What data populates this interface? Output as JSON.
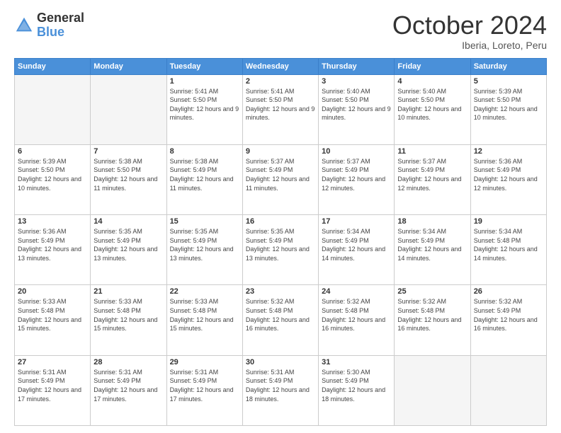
{
  "logo": {
    "general": "General",
    "blue": "Blue"
  },
  "header": {
    "month": "October 2024",
    "location": "Iberia, Loreto, Peru"
  },
  "weekdays": [
    "Sunday",
    "Monday",
    "Tuesday",
    "Wednesday",
    "Thursday",
    "Friday",
    "Saturday"
  ],
  "weeks": [
    [
      {
        "day": "",
        "info": ""
      },
      {
        "day": "",
        "info": ""
      },
      {
        "day": "1",
        "info": "Sunrise: 5:41 AM\nSunset: 5:50 PM\nDaylight: 12 hours and 9 minutes."
      },
      {
        "day": "2",
        "info": "Sunrise: 5:41 AM\nSunset: 5:50 PM\nDaylight: 12 hours and 9 minutes."
      },
      {
        "day": "3",
        "info": "Sunrise: 5:40 AM\nSunset: 5:50 PM\nDaylight: 12 hours and 9 minutes."
      },
      {
        "day": "4",
        "info": "Sunrise: 5:40 AM\nSunset: 5:50 PM\nDaylight: 12 hours and 10 minutes."
      },
      {
        "day": "5",
        "info": "Sunrise: 5:39 AM\nSunset: 5:50 PM\nDaylight: 12 hours and 10 minutes."
      }
    ],
    [
      {
        "day": "6",
        "info": "Sunrise: 5:39 AM\nSunset: 5:50 PM\nDaylight: 12 hours and 10 minutes."
      },
      {
        "day": "7",
        "info": "Sunrise: 5:38 AM\nSunset: 5:50 PM\nDaylight: 12 hours and 11 minutes."
      },
      {
        "day": "8",
        "info": "Sunrise: 5:38 AM\nSunset: 5:49 PM\nDaylight: 12 hours and 11 minutes."
      },
      {
        "day": "9",
        "info": "Sunrise: 5:37 AM\nSunset: 5:49 PM\nDaylight: 12 hours and 11 minutes."
      },
      {
        "day": "10",
        "info": "Sunrise: 5:37 AM\nSunset: 5:49 PM\nDaylight: 12 hours and 12 minutes."
      },
      {
        "day": "11",
        "info": "Sunrise: 5:37 AM\nSunset: 5:49 PM\nDaylight: 12 hours and 12 minutes."
      },
      {
        "day": "12",
        "info": "Sunrise: 5:36 AM\nSunset: 5:49 PM\nDaylight: 12 hours and 12 minutes."
      }
    ],
    [
      {
        "day": "13",
        "info": "Sunrise: 5:36 AM\nSunset: 5:49 PM\nDaylight: 12 hours and 13 minutes."
      },
      {
        "day": "14",
        "info": "Sunrise: 5:35 AM\nSunset: 5:49 PM\nDaylight: 12 hours and 13 minutes."
      },
      {
        "day": "15",
        "info": "Sunrise: 5:35 AM\nSunset: 5:49 PM\nDaylight: 12 hours and 13 minutes."
      },
      {
        "day": "16",
        "info": "Sunrise: 5:35 AM\nSunset: 5:49 PM\nDaylight: 12 hours and 13 minutes."
      },
      {
        "day": "17",
        "info": "Sunrise: 5:34 AM\nSunset: 5:49 PM\nDaylight: 12 hours and 14 minutes."
      },
      {
        "day": "18",
        "info": "Sunrise: 5:34 AM\nSunset: 5:49 PM\nDaylight: 12 hours and 14 minutes."
      },
      {
        "day": "19",
        "info": "Sunrise: 5:34 AM\nSunset: 5:48 PM\nDaylight: 12 hours and 14 minutes."
      }
    ],
    [
      {
        "day": "20",
        "info": "Sunrise: 5:33 AM\nSunset: 5:48 PM\nDaylight: 12 hours and 15 minutes."
      },
      {
        "day": "21",
        "info": "Sunrise: 5:33 AM\nSunset: 5:48 PM\nDaylight: 12 hours and 15 minutes."
      },
      {
        "day": "22",
        "info": "Sunrise: 5:33 AM\nSunset: 5:48 PM\nDaylight: 12 hours and 15 minutes."
      },
      {
        "day": "23",
        "info": "Sunrise: 5:32 AM\nSunset: 5:48 PM\nDaylight: 12 hours and 16 minutes."
      },
      {
        "day": "24",
        "info": "Sunrise: 5:32 AM\nSunset: 5:48 PM\nDaylight: 12 hours and 16 minutes."
      },
      {
        "day": "25",
        "info": "Sunrise: 5:32 AM\nSunset: 5:48 PM\nDaylight: 12 hours and 16 minutes."
      },
      {
        "day": "26",
        "info": "Sunrise: 5:32 AM\nSunset: 5:49 PM\nDaylight: 12 hours and 16 minutes."
      }
    ],
    [
      {
        "day": "27",
        "info": "Sunrise: 5:31 AM\nSunset: 5:49 PM\nDaylight: 12 hours and 17 minutes."
      },
      {
        "day": "28",
        "info": "Sunrise: 5:31 AM\nSunset: 5:49 PM\nDaylight: 12 hours and 17 minutes."
      },
      {
        "day": "29",
        "info": "Sunrise: 5:31 AM\nSunset: 5:49 PM\nDaylight: 12 hours and 17 minutes."
      },
      {
        "day": "30",
        "info": "Sunrise: 5:31 AM\nSunset: 5:49 PM\nDaylight: 12 hours and 18 minutes."
      },
      {
        "day": "31",
        "info": "Sunrise: 5:30 AM\nSunset: 5:49 PM\nDaylight: 12 hours and 18 minutes."
      },
      {
        "day": "",
        "info": ""
      },
      {
        "day": "",
        "info": ""
      }
    ]
  ]
}
